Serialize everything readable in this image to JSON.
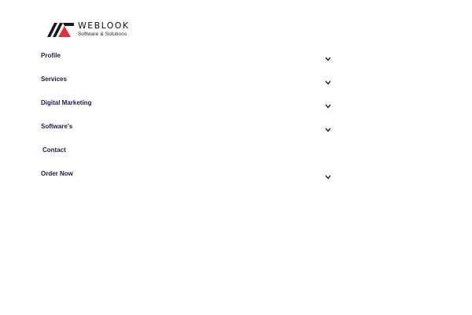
{
  "brand": {
    "name": "WEBLOOK",
    "tagline": "Software & Solutions",
    "colors": {
      "mark_dark": "#1a1a1a",
      "mark_accent": "#e0313a",
      "menu_text": "#1b1b4b"
    }
  },
  "menu": {
    "items": [
      {
        "label": "Profile",
        "expand_icon": "chevron-down-icon"
      },
      {
        "label": "Services",
        "expand_icon": "chevron-down-icon"
      },
      {
        "label": "Digital Marketing",
        "expand_icon": "chevron-down-icon"
      },
      {
        "label": "Software's",
        "expand_icon": "chevron-down-icon"
      },
      {
        "label": "Contact"
      },
      {
        "label": "Order Now",
        "expand_icon": "chevron-down-icon"
      }
    ]
  }
}
